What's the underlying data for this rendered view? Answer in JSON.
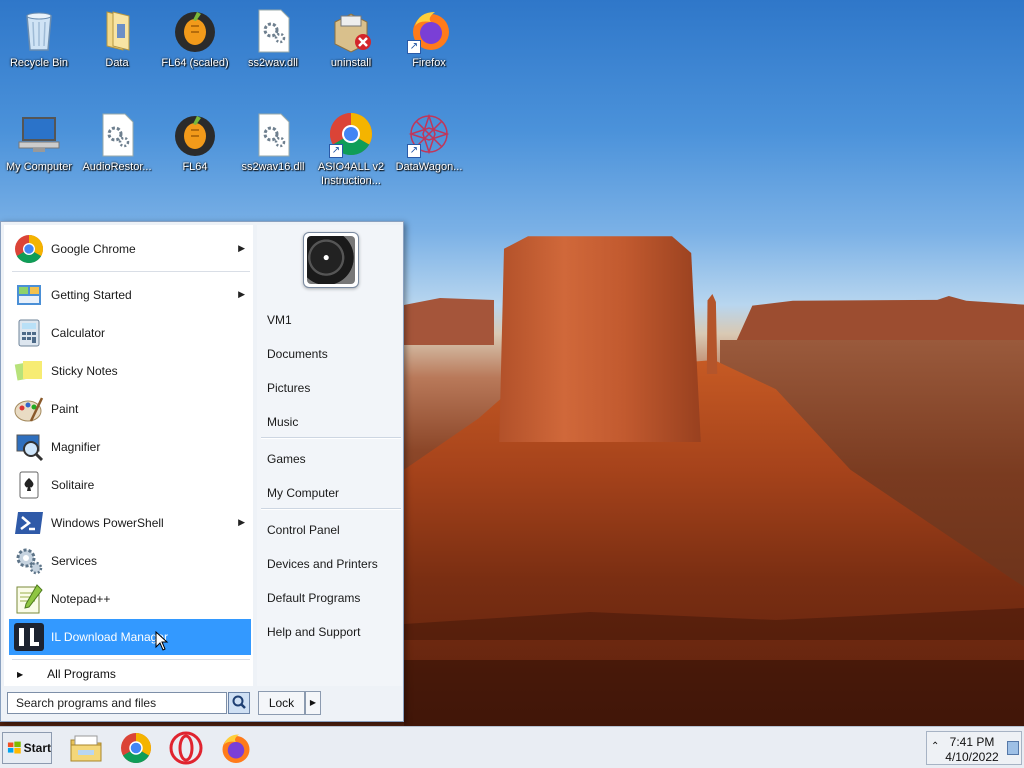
{
  "desktop_icons": [
    {
      "label": "Recycle Bin",
      "icon": "recycle-bin-icon"
    },
    {
      "label": "Data",
      "icon": "folder-icon"
    },
    {
      "label": "FL64 (scaled)",
      "icon": "fl-studio-icon"
    },
    {
      "label": "ss2wav.dll",
      "icon": "dll-file-icon"
    },
    {
      "label": "uninstall",
      "icon": "nsis-installer-icon"
    },
    {
      "label": "Firefox",
      "icon": "firefox-icon"
    },
    {
      "label": "My Computer",
      "icon": "computer-icon"
    },
    {
      "label": "AudioRestor...",
      "icon": "dll-file-icon"
    },
    {
      "label": "FL64",
      "icon": "fl-studio-icon"
    },
    {
      "label": "ss2wav16.dll",
      "icon": "dll-file-icon"
    },
    {
      "label": "ASIO4ALL v2 Instruction...",
      "icon": "chrome-icon"
    },
    {
      "label": "DataWagon...",
      "icon": "datawagon-icon"
    }
  ],
  "start_menu": {
    "pinned": [
      {
        "label": "Google Chrome",
        "icon": "chrome-icon",
        "has_submenu": true
      }
    ],
    "recent": [
      {
        "label": "Getting Started",
        "icon": "getting-started-icon",
        "has_submenu": true
      },
      {
        "label": "Calculator",
        "icon": "calculator-icon",
        "has_submenu": false
      },
      {
        "label": "Sticky Notes",
        "icon": "sticky-notes-icon",
        "has_submenu": false
      },
      {
        "label": "Paint",
        "icon": "paint-icon",
        "has_submenu": false
      },
      {
        "label": "Magnifier",
        "icon": "magnifier-icon",
        "has_submenu": false
      },
      {
        "label": "Solitaire",
        "icon": "solitaire-icon",
        "has_submenu": false
      },
      {
        "label": "Windows PowerShell",
        "icon": "powershell-icon",
        "has_submenu": true
      },
      {
        "label": "Services",
        "icon": "services-icon",
        "has_submenu": false
      },
      {
        "label": "Notepad++",
        "icon": "notepad-plus-plus-icon",
        "has_submenu": false
      },
      {
        "label": "IL Download Manager",
        "icon": "il-download-manager-icon",
        "has_submenu": false,
        "selected": true
      }
    ],
    "all_programs": "All Programs",
    "search_placeholder": "Search programs and files",
    "right_links": {
      "group1": [
        "VM1",
        "Documents",
        "Pictures",
        "Music"
      ],
      "group2": [
        "Games",
        "My Computer"
      ],
      "group3": [
        "Control Panel",
        "Devices and Printers",
        "Default Programs",
        "Help and Support"
      ]
    },
    "lock_label": "Lock",
    "selection_color": "#3399ff"
  },
  "taskbar": {
    "start_label": "Start",
    "apps": [
      "file-explorer-icon",
      "chrome-icon",
      "opera-icon",
      "firefox-icon"
    ],
    "clock_time": "7:41 PM",
    "clock_date": "4/10/2022"
  }
}
